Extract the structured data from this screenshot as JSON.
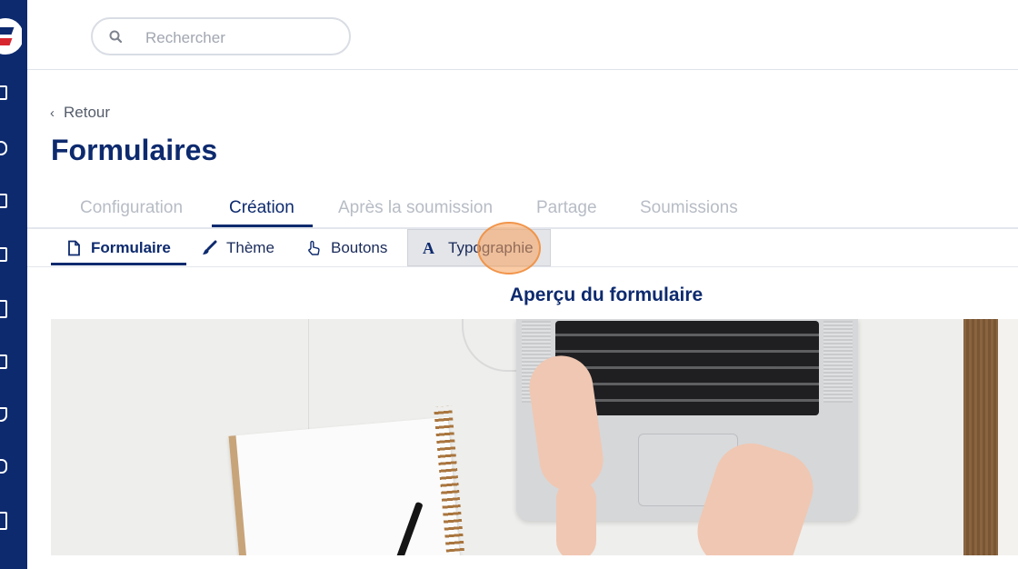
{
  "search": {
    "placeholder": "Rechercher"
  },
  "nav": {
    "back_label": "Retour"
  },
  "page": {
    "title": "Formulaires"
  },
  "tabs": [
    {
      "label": "Configuration",
      "active": false
    },
    {
      "label": "Création",
      "active": true
    },
    {
      "label": "Après la soumission",
      "active": false
    },
    {
      "label": "Partage",
      "active": false
    },
    {
      "label": "Soumissions",
      "active": false
    }
  ],
  "subtabs": [
    {
      "label": "Formulaire",
      "icon": "document-icon",
      "active": true
    },
    {
      "label": "Thème",
      "icon": "brush-icon",
      "active": false
    },
    {
      "label": "Boutons",
      "icon": "pointer-hand-icon",
      "active": false
    },
    {
      "label": "Typographie",
      "icon": "typography-icon",
      "active": false,
      "hovered": true
    }
  ],
  "preview": {
    "title": "Aperçu du formulaire"
  },
  "colors": {
    "brand_navy": "#0d2a6e",
    "brand_red": "#d8262e",
    "inactive_tab": "#b7bcc5"
  }
}
